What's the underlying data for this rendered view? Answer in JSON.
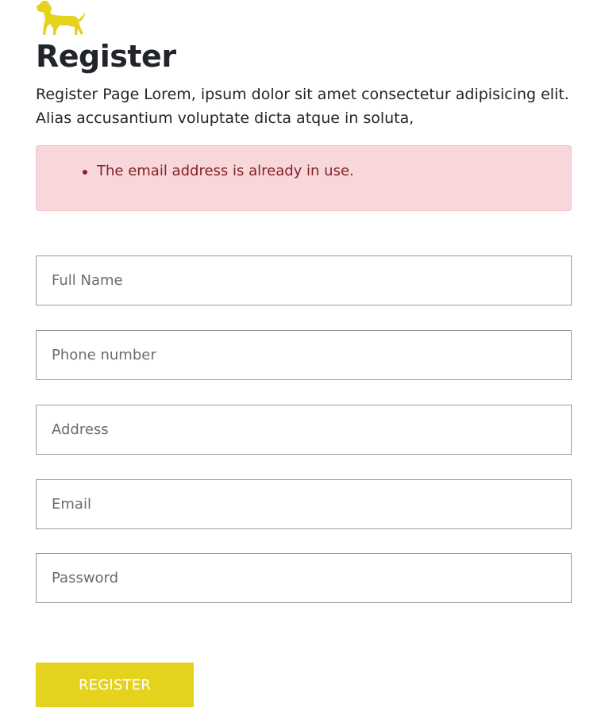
{
  "colors": {
    "brand": "#e4d21c",
    "alert_bg": "#f8d7da",
    "alert_text": "#842029",
    "text": "#212529"
  },
  "logo": {
    "icon": "dog-icon"
  },
  "header": {
    "title": "Register",
    "intro": "Register Page Lorem, ipsum dolor sit amet consectetur adipisicing elit. Alias accusantium voluptate dicta atque in soluta,"
  },
  "alert": {
    "errors": [
      "The email address is already in use."
    ]
  },
  "form": {
    "full_name": {
      "placeholder": "Full Name",
      "value": ""
    },
    "phone": {
      "placeholder": "Phone number",
      "value": ""
    },
    "address": {
      "placeholder": "Address",
      "value": ""
    },
    "email": {
      "placeholder": "Email",
      "value": ""
    },
    "password": {
      "placeholder": "Password",
      "value": ""
    },
    "submit_label": "REGISTER"
  }
}
